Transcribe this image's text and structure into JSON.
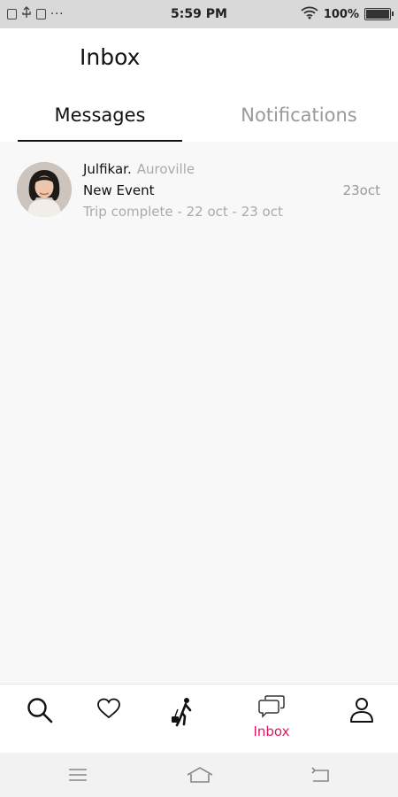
{
  "status_bar": {
    "time": "5:59 PM",
    "battery_text": "100%",
    "battery_level": 1.0,
    "notification_dots": "···",
    "icons": [
      "notification-icon",
      "usb-icon",
      "app-icon",
      "wifi-icon",
      "battery-icon"
    ]
  },
  "header": {
    "title": "Inbox",
    "tabs": [
      {
        "label": "Messages",
        "active": true
      },
      {
        "label": "Notifications",
        "active": false
      }
    ]
  },
  "messages": [
    {
      "sender": "Julfikar.",
      "location": "Auroville",
      "title": "New Event",
      "preview": "Trip complete - 22 oct - 23 oct",
      "date": "23oct"
    }
  ],
  "bottom_nav": {
    "items": [
      {
        "icon": "search-icon",
        "label": ""
      },
      {
        "icon": "heart-icon",
        "label": ""
      },
      {
        "icon": "traveler-icon",
        "label": ""
      },
      {
        "icon": "chat-bubbles-icon",
        "label": "Inbox",
        "active": true
      },
      {
        "icon": "profile-icon",
        "label": ""
      }
    ],
    "active_color": "#d81b60"
  },
  "system_nav": {
    "icons": [
      "menu-icon",
      "home-icon",
      "back-icon"
    ]
  },
  "colors": {
    "accent": "#d81b60",
    "text_primary": "#111111",
    "text_secondary": "#aaaaaa"
  }
}
